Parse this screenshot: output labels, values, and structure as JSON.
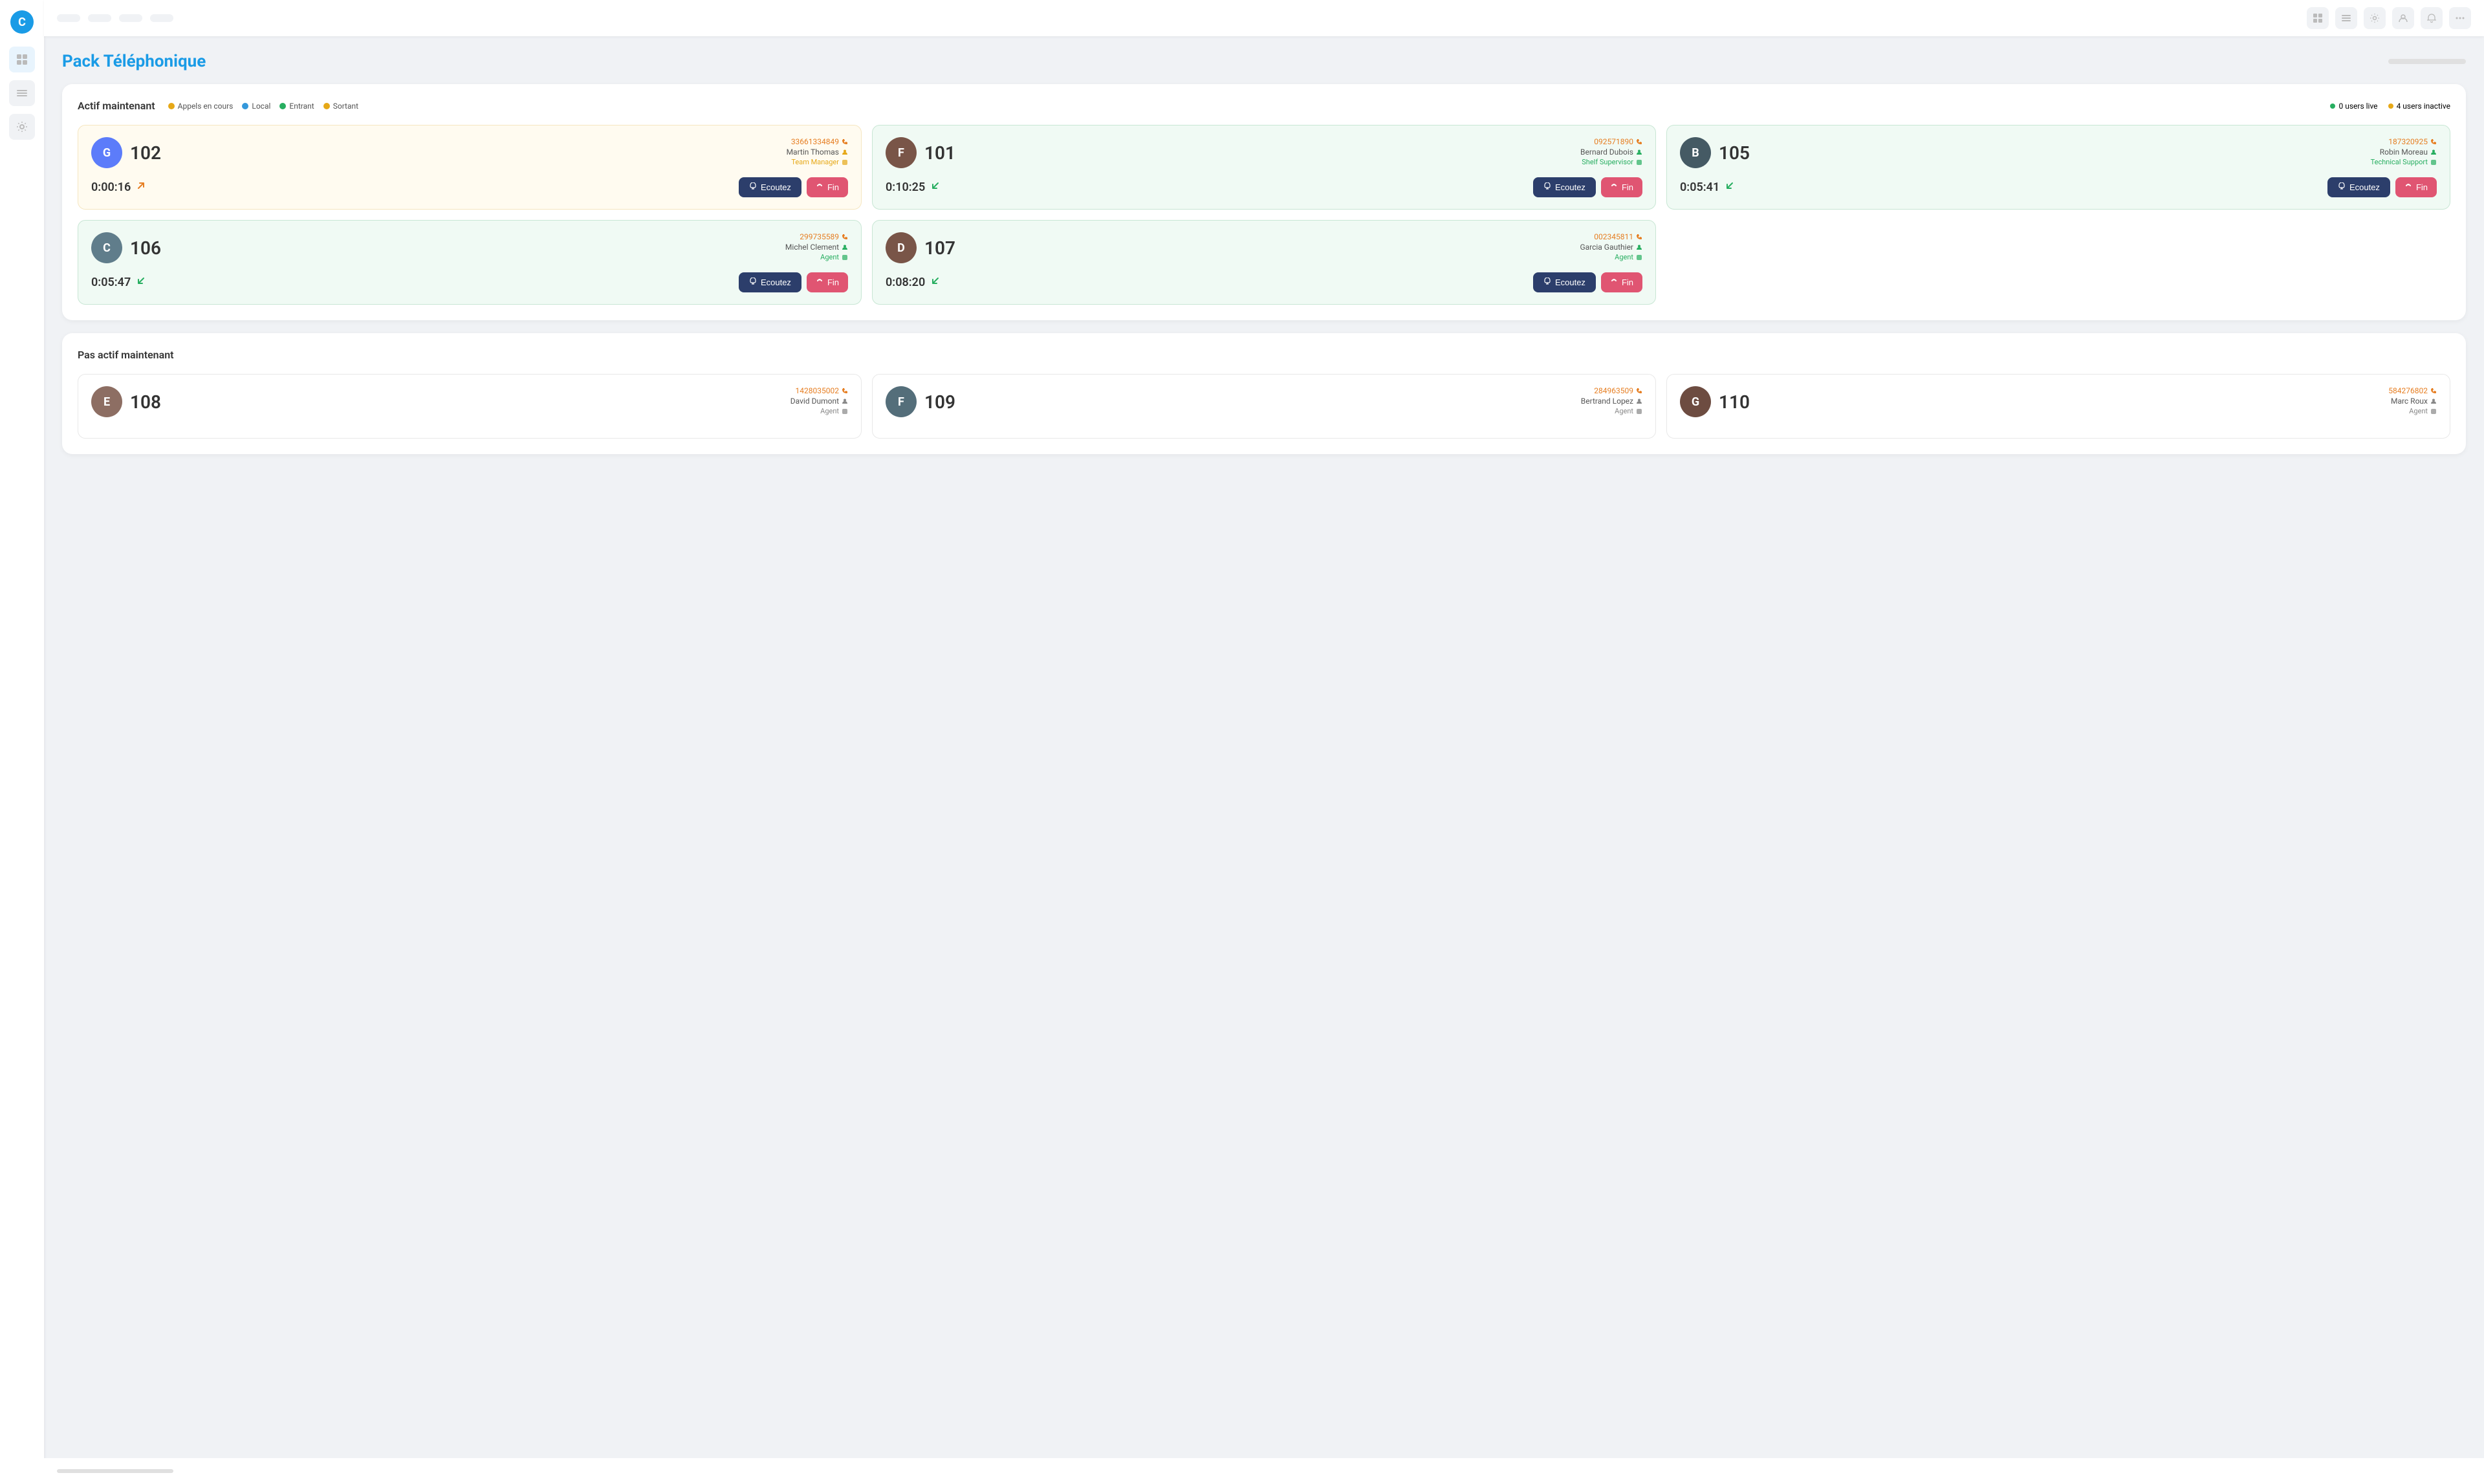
{
  "app": {
    "logo": "C",
    "title": "Pack Téléphonique"
  },
  "topnav": {
    "pills": [
      "",
      "",
      "",
      ""
    ],
    "icons": [
      "grid",
      "list",
      "settings",
      "user",
      "bell",
      "more"
    ]
  },
  "active_section": {
    "title": "Actif maintenant",
    "legend": [
      {
        "label": "Appels en cours",
        "color": "#e6a817"
      },
      {
        "label": "Local",
        "color": "#3498db"
      },
      {
        "label": "Entrant",
        "color": "#27ae60"
      },
      {
        "label": "Sortant",
        "color": "#e6a817"
      }
    ],
    "status": {
      "live": "0 users live",
      "inactive": "4 users inactive"
    },
    "cards": [
      {
        "id": "102",
        "number": "102",
        "phone": "33661334849",
        "agent_name": "Martin Thomas",
        "role": "Team Manager",
        "timer": "0:00:16",
        "call_type": "outgoing",
        "type": "yellow"
      },
      {
        "id": "101",
        "number": "101",
        "phone": "092571890",
        "agent_name": "Bernard Dubois",
        "role": "Shelf Supervisor",
        "timer": "0:10:25",
        "call_type": "incoming",
        "type": "green"
      },
      {
        "id": "105",
        "number": "105",
        "phone": "187320925",
        "agent_name": "Robin Moreau",
        "role": "Technical Support",
        "timer": "0:05:41",
        "call_type": "incoming",
        "type": "green"
      },
      {
        "id": "106",
        "number": "106",
        "phone": "299735589",
        "agent_name": "Michel Clement",
        "role": "Agent",
        "timer": "0:05:47",
        "call_type": "incoming",
        "type": "green"
      },
      {
        "id": "107",
        "number": "107",
        "phone": "002345811",
        "agent_name": "Garcia Gauthier",
        "role": "Agent",
        "timer": "0:08:20",
        "call_type": "incoming",
        "type": "green"
      }
    ],
    "btn_listen": "Ecoutez",
    "btn_end": "Fin"
  },
  "inactive_section": {
    "title": "Pas actif maintenant",
    "cards": [
      {
        "id": "108",
        "number": "108",
        "phone": "1428035002",
        "agent_name": "David Dumont",
        "role": "Agent"
      },
      {
        "id": "109",
        "number": "109",
        "phone": "284963509",
        "agent_name": "Bertrand Lopez",
        "role": "Agent"
      },
      {
        "id": "110",
        "number": "110",
        "phone": "584276802",
        "agent_name": "Marc Roux",
        "role": "Agent"
      }
    ]
  },
  "avatar_colors": {
    "102": "#5c7cfa",
    "101": "#795548",
    "105": "#455a64",
    "106": "#607d8b",
    "107": "#795548",
    "108": "#8d6e63",
    "109": "#546e7a",
    "110": "#6d4c41"
  }
}
